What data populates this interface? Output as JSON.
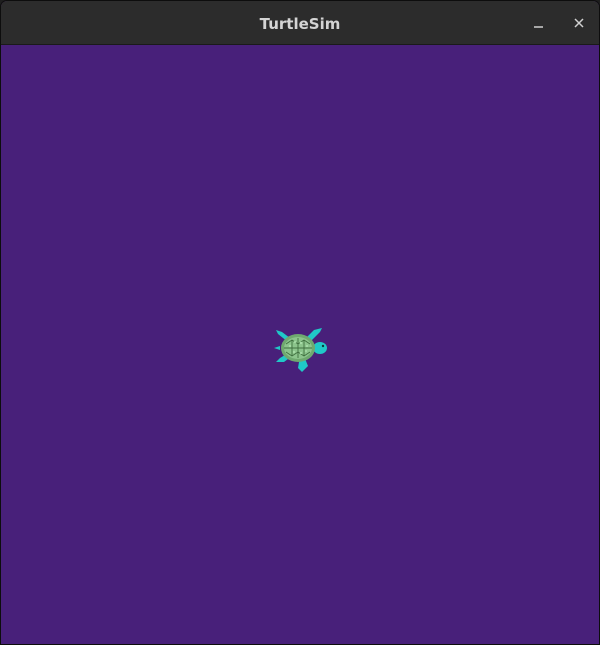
{
  "window": {
    "title": "TurtleSim"
  },
  "canvas": {
    "background_color": "#48207a"
  },
  "turtle": {
    "icon": "turtle-icon",
    "shell_color": "#7fbf7f",
    "limb_color": "#20c8c8"
  },
  "controls": {
    "minimize_icon": "minimize-icon",
    "close_icon": "close-icon"
  }
}
